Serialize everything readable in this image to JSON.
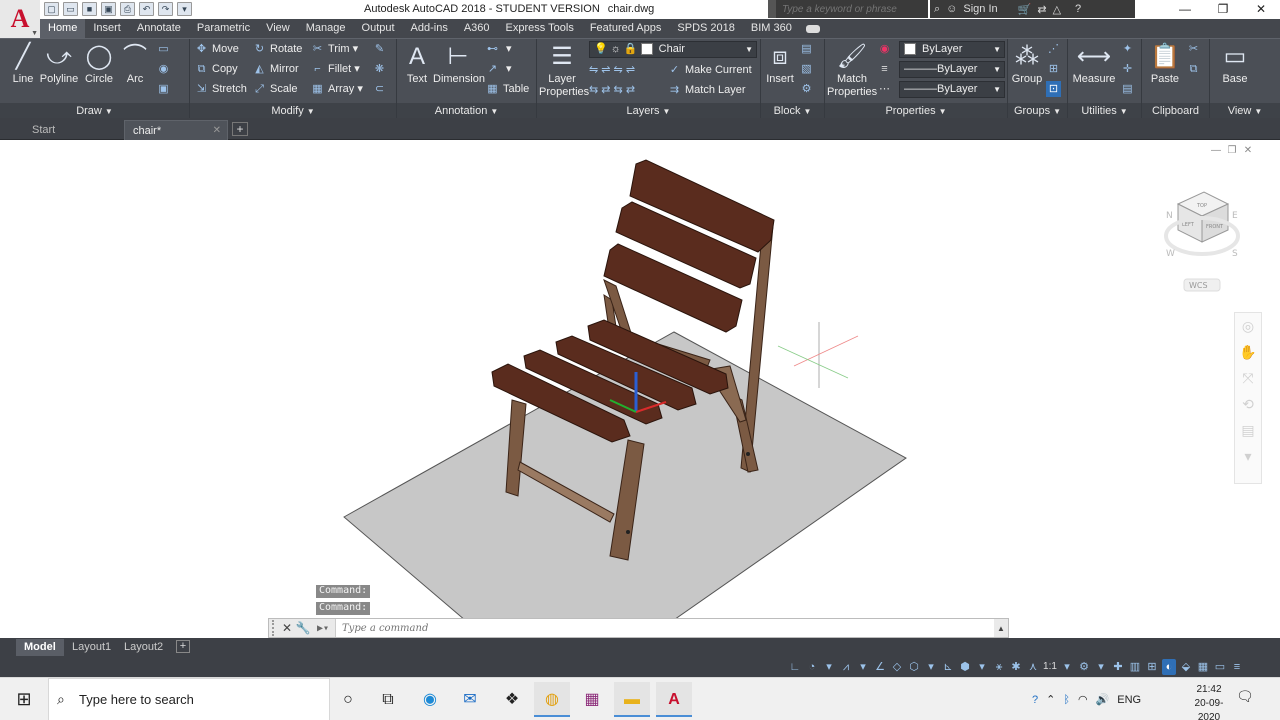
{
  "title": {
    "app": "Autodesk AutoCAD 2018 - STUDENT VERSION",
    "file": "chair.dwg",
    "logo": "A",
    "search_placeholder": "Type a keyword or phrase",
    "sign_in": "Sign In"
  },
  "ribbon_tabs": [
    "Home",
    "Insert",
    "Annotate",
    "Parametric",
    "View",
    "Manage",
    "Output",
    "Add-ins",
    "A360",
    "Express Tools",
    "Featured Apps",
    "SPDS 2018",
    "BIM 360"
  ],
  "panels": {
    "draw": {
      "label": "Draw",
      "line": "Line",
      "polyline": "Polyline",
      "circle": "Circle",
      "arc": "Arc"
    },
    "modify": {
      "label": "Modify",
      "move": "Move",
      "rotate": "Rotate",
      "trim": "Trim",
      "copy": "Copy",
      "mirror": "Mirror",
      "fillet": "Fillet",
      "stretch": "Stretch",
      "scale": "Scale",
      "array": "Array"
    },
    "annotation": {
      "label": "Annotation",
      "text": "Text",
      "dimension": "Dimension",
      "table": "Table"
    },
    "layers": {
      "label": "Layers",
      "layer_properties": "Layer Properties",
      "current_layer": "Chair",
      "make_current": "Make Current",
      "match_layer": "Match Layer"
    },
    "block": {
      "label": "Block",
      "insert": "Insert"
    },
    "properties": {
      "label": "Properties",
      "match_properties": "Match Properties",
      "color": "ByLayer",
      "linetype": "ByLayer",
      "lineweight": "ByLayer"
    },
    "groups": {
      "label": "Groups",
      "group": "Group"
    },
    "utilities": {
      "label": "Utilities",
      "measure": "Measure"
    },
    "clipboard": {
      "label": "Clipboard",
      "paste": "Paste"
    },
    "view": {
      "label": "View",
      "base": "Base"
    }
  },
  "file_tabs": {
    "start": "Start",
    "current": "chair*"
  },
  "viewcube": {
    "top": "TOP",
    "front": "FRONT",
    "left": "LEFT",
    "ucs": "WCS",
    "w": "W",
    "s": "S",
    "n": "N",
    "e": "E"
  },
  "command": {
    "history": [
      "Command:",
      "Command:"
    ],
    "placeholder": "Type a command"
  },
  "layout_tabs": [
    "Model",
    "Layout1",
    "Layout2"
  ],
  "status": {
    "scale": "1:1"
  },
  "taskbar": {
    "search_placeholder": "Type here to search",
    "time": "21:42",
    "date": "20-09-2020",
    "lang": "ENG"
  },
  "colors": {
    "ribbon": "#4b4f56",
    "tabbar": "#44474d",
    "accent": "#2f6fb6",
    "chair_wood": "#5a2c1e",
    "floor": "#c7c7c7"
  }
}
